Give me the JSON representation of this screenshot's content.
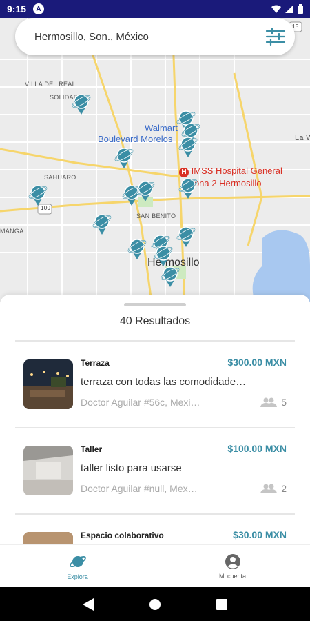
{
  "status_bar": {
    "time": "9:15",
    "notification_badge": "A"
  },
  "search": {
    "location": "Hermosillo, Son., México"
  },
  "map": {
    "labels": [
      "VILLA DEL REAL",
      "SOLIDAR",
      "SAHUARO",
      "SAN BENITO",
      "MANGA",
      "La W"
    ],
    "road_shield": "100",
    "road_shield_2": "15",
    "pois": [
      "Walmart",
      "Boulevard Morelos",
      "IMSS Hospital General",
      "Zona 2 Hermosillo"
    ],
    "city": "Hermosillo",
    "pin_color": "#3b8ea5"
  },
  "results": {
    "count_label": "40 Resultados",
    "listings": [
      {
        "category": "Terraza",
        "price": "$300.00 MXN",
        "title": "terraza con todas las comodidade…",
        "address": "Doctor Aguilar #56c, Mexi…",
        "capacity": "5"
      },
      {
        "category": "Taller",
        "price": "$100.00 MXN",
        "title": "taller listo para usarse",
        "address": "Doctor Aguilar #null, Mex…",
        "capacity": "2"
      },
      {
        "category": "Espacio colaborativo",
        "price": "$30.00 MXN",
        "title": "",
        "address": "",
        "capacity": ""
      }
    ]
  },
  "nav": {
    "explore_label": "Explora",
    "account_label": "Mi cuenta",
    "active_color": "#3b8ea5"
  }
}
